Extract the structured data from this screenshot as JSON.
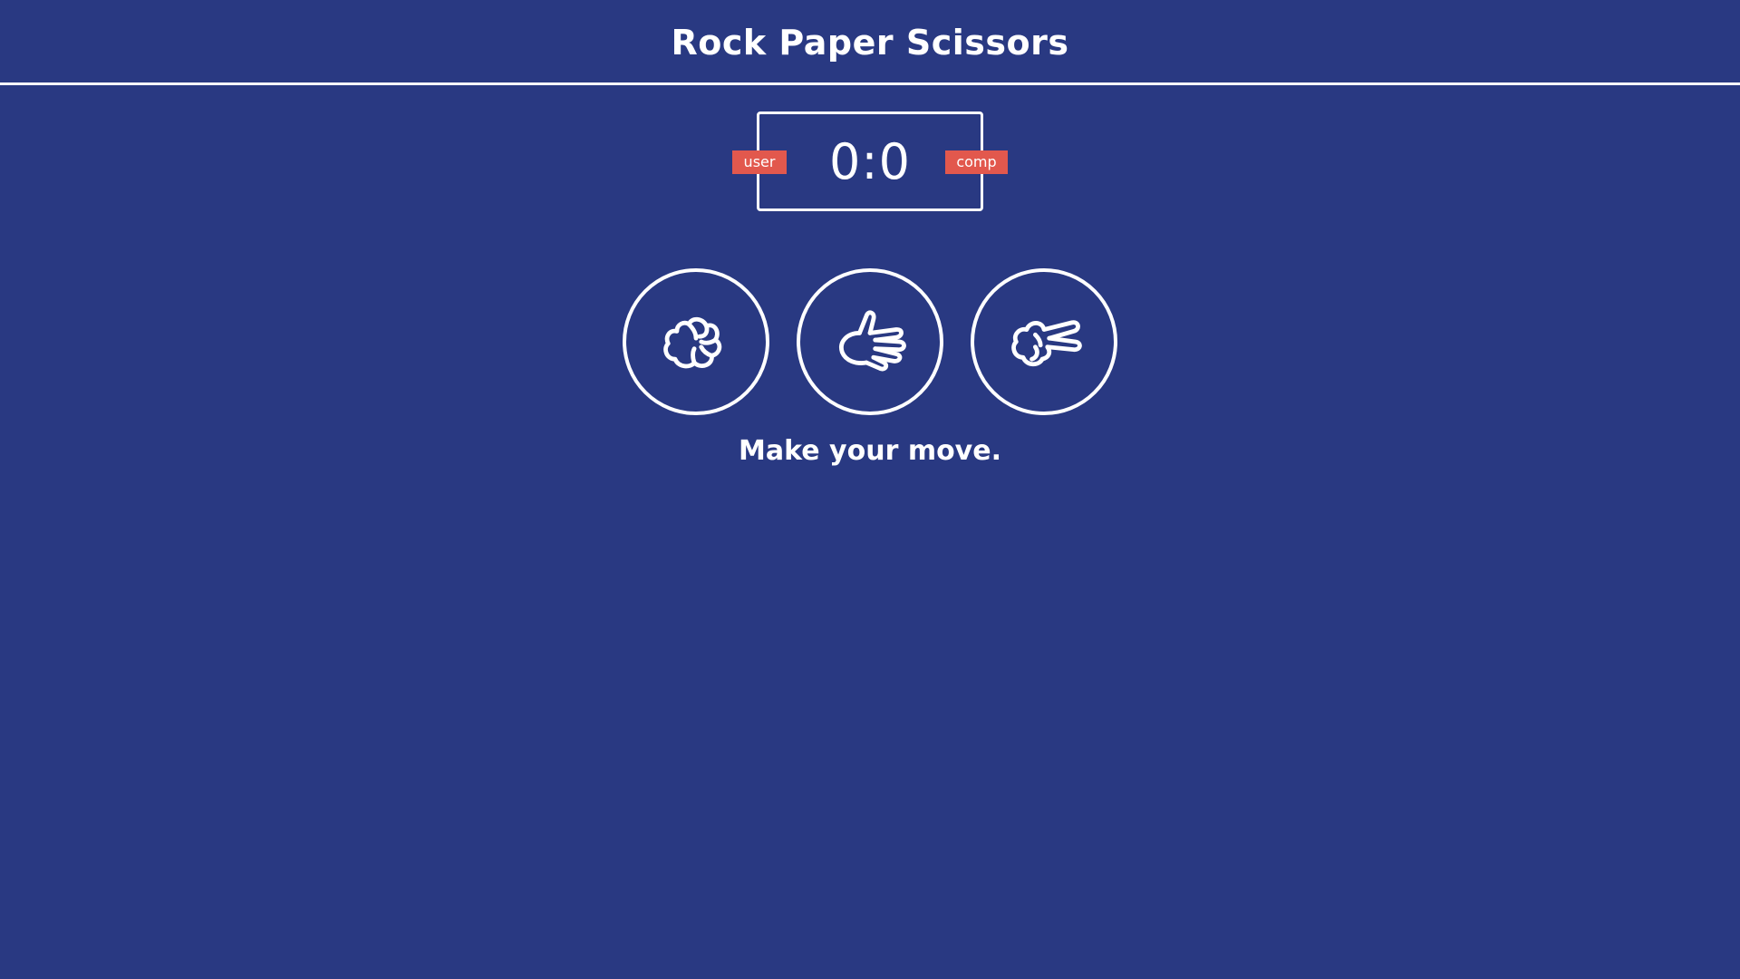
{
  "header": {
    "title": "Rock Paper Scissors"
  },
  "scoreboard": {
    "score": "0:0",
    "user_label": "user",
    "comp_label": "comp",
    "badge_color": "#e2584d"
  },
  "choices": [
    {
      "id": "rock",
      "icon": "rock-hand-icon"
    },
    {
      "id": "paper",
      "icon": "paper-hand-icon"
    },
    {
      "id": "scissors",
      "icon": "scissors-hand-icon"
    }
  ],
  "message": "Make your move.",
  "colors": {
    "background": "#293982",
    "foreground": "#ffffff"
  }
}
